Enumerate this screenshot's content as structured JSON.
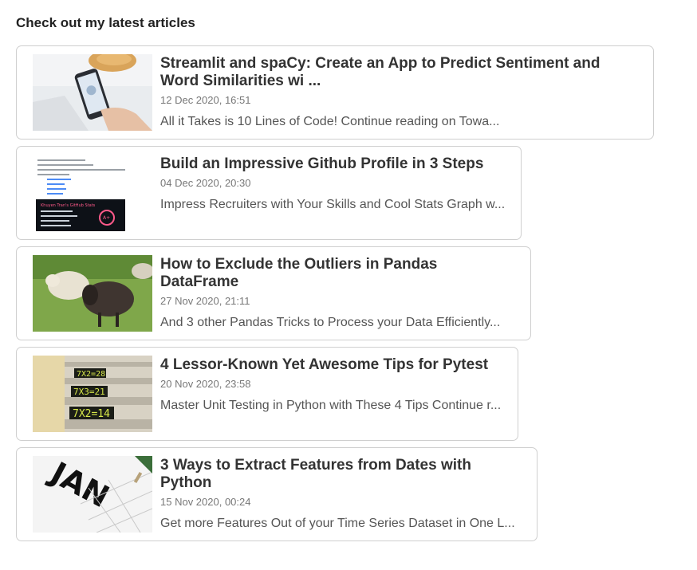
{
  "section": {
    "heading": "Check out my latest articles"
  },
  "articles": [
    {
      "title": "Streamlit and spaCy: Create an App to Predict Sentiment and Word Similarities wi ...",
      "date": "12 Dec 2020, 16:51",
      "description": "All it Takes is 10 Lines of Code! Continue reading on Towa...",
      "thumbnail": "phone-app-photo"
    },
    {
      "title": "Build an Impressive Github Profile in 3 Steps",
      "date": "04 Dec 2020, 20:30",
      "description": "Impress Recruiters with Your Skills and Cool Stats Graph w...",
      "thumbnail": "github-profile-screenshot"
    },
    {
      "title": "How to Exclude the Outliers in Pandas DataFrame",
      "date": "27 Nov 2020, 21:11",
      "description": "And 3 other Pandas Tricks to Process your Data Efficiently...",
      "thumbnail": "sheep-photo"
    },
    {
      "title": "4 Lessor-Known Yet Awesome Tips for Pytest",
      "date": "20 Nov 2020, 23:58",
      "description": "Master Unit Testing in Python with These 4 Tips Continue r...",
      "thumbnail": "math-stairs-photo"
    },
    {
      "title": "3 Ways to Extract Features from Dates with Python",
      "date": "15 Nov 2020, 00:24",
      "description": "Get more Features Out of your Time Series Dataset in One L...",
      "thumbnail": "calendar-photo"
    }
  ],
  "thumb_text": {
    "github_stats_title": "Khuyen Tran's GitHub Stats",
    "github_grade": "A+",
    "stair_1": "7X2=28",
    "stair_2": "7X3=21",
    "stair_3": "7X2=14",
    "calendar_month": "JAN"
  }
}
